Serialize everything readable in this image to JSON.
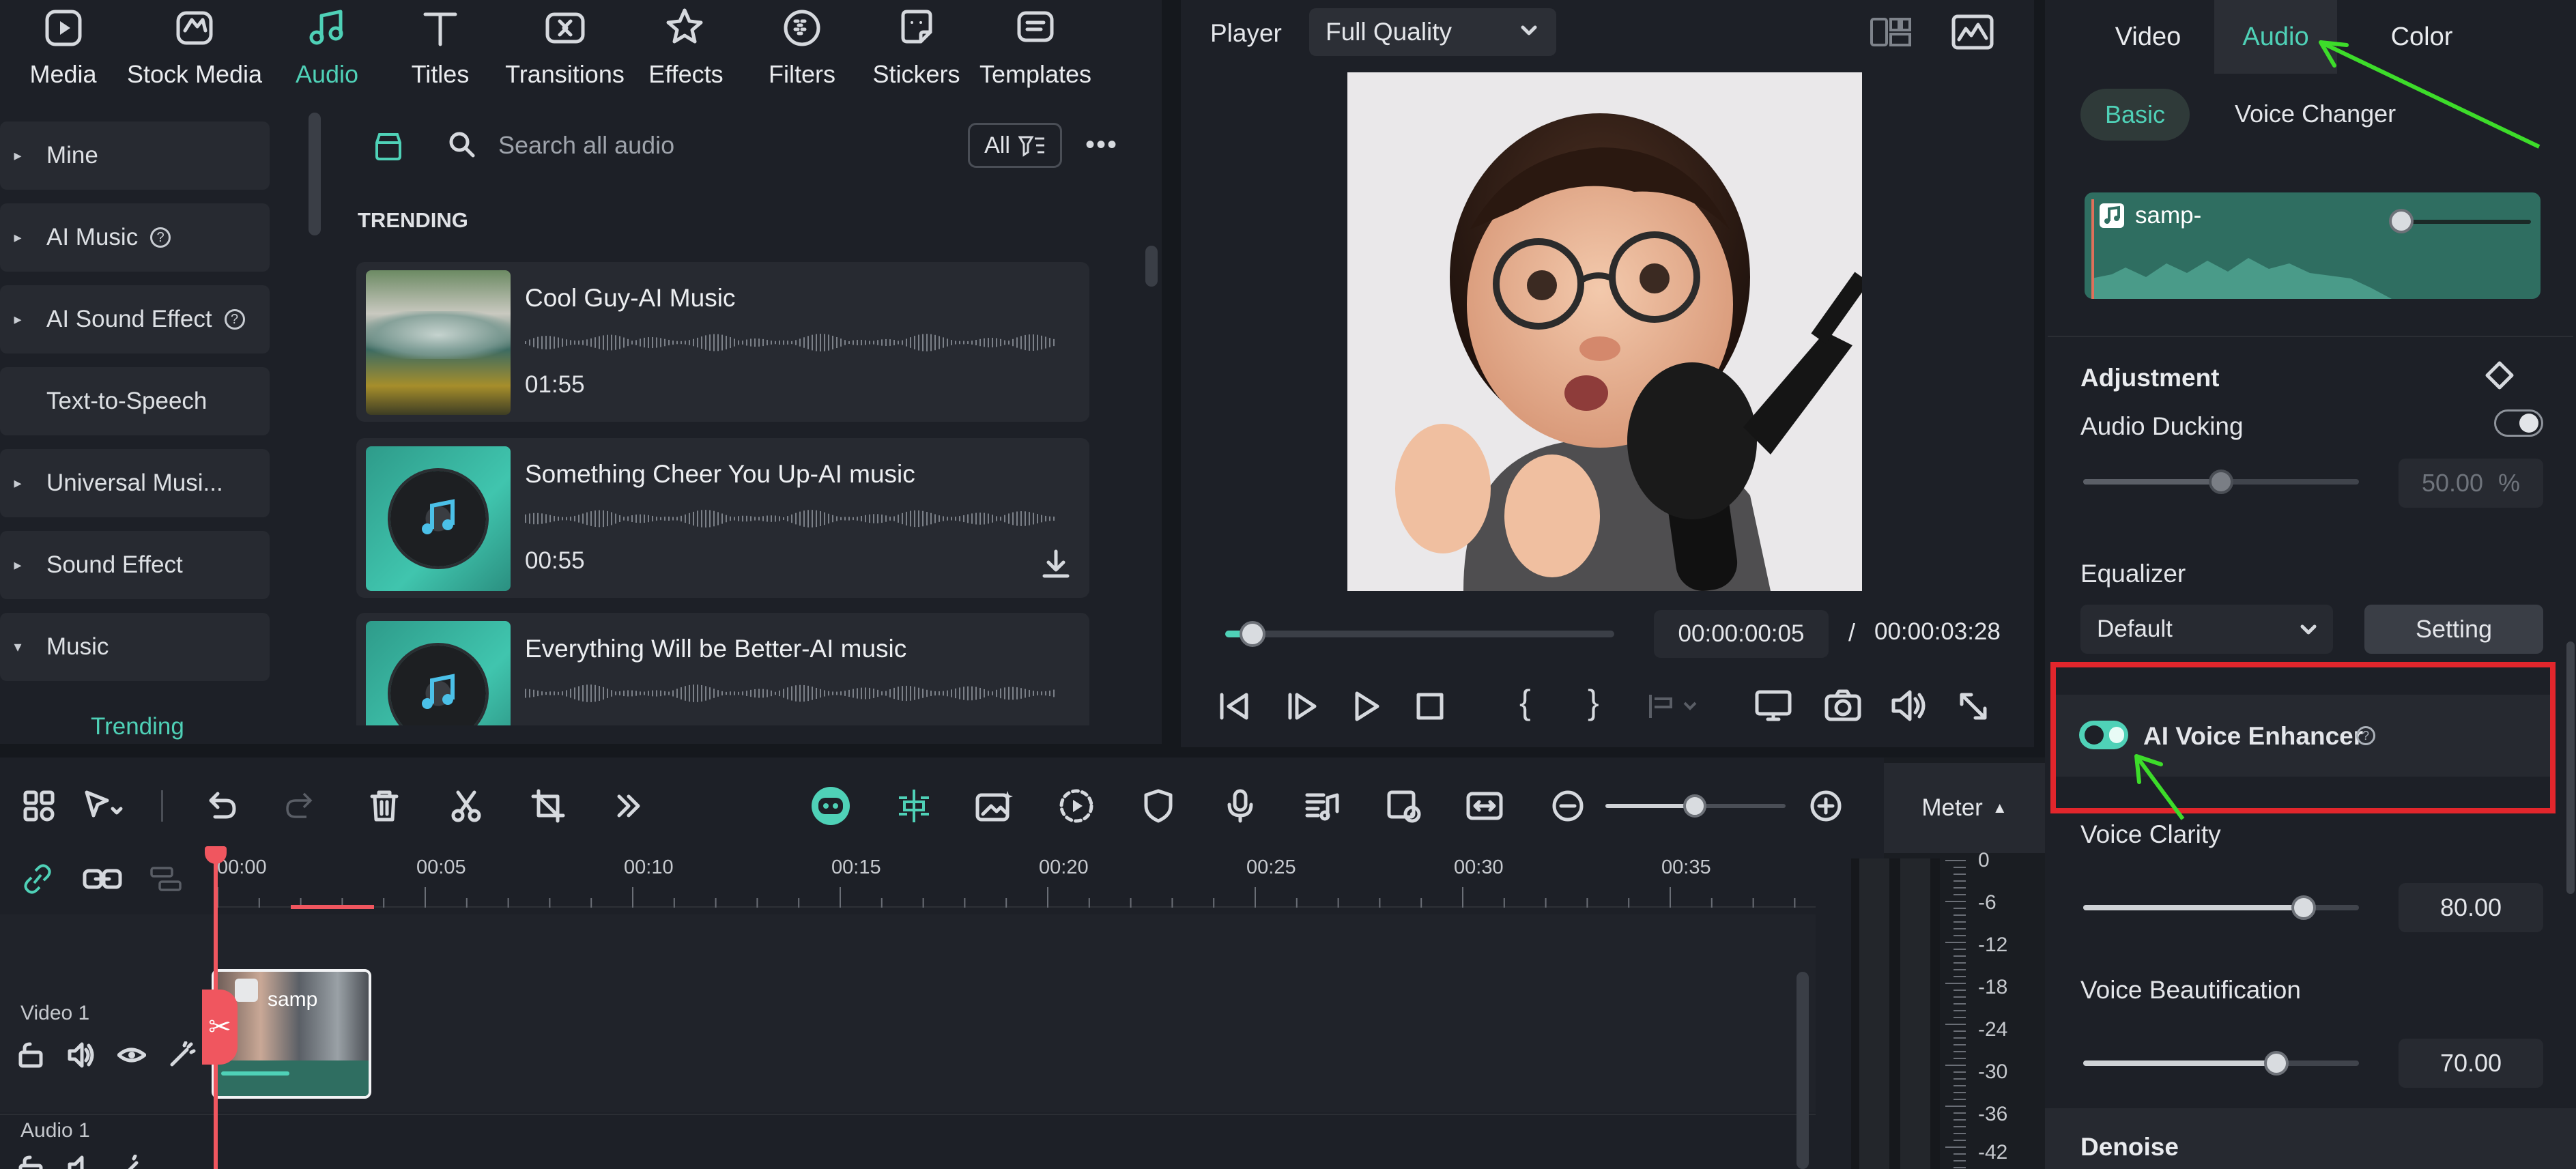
{
  "media_nav": {
    "tabs": [
      {
        "label": "Media",
        "icon": "media-icon"
      },
      {
        "label": "Stock Media",
        "icon": "stock-media-icon"
      },
      {
        "label": "Audio",
        "icon": "music-note-icon",
        "active": true
      },
      {
        "label": "Titles",
        "icon": "text-t-icon"
      },
      {
        "label": "Transitions",
        "icon": "transitions-icon"
      },
      {
        "label": "Effects",
        "icon": "effects-star-icon"
      },
      {
        "label": "Filters",
        "icon": "filters-icon"
      },
      {
        "label": "Stickers",
        "icon": "stickers-icon"
      },
      {
        "label": "Templates",
        "icon": "templates-icon"
      }
    ]
  },
  "sidebar": {
    "items": [
      {
        "label": "Mine",
        "caret": "▸"
      },
      {
        "label": "AI Music",
        "caret": "▸",
        "help": "?"
      },
      {
        "label": "AI Sound Effect",
        "caret": "▸",
        "help": "?"
      },
      {
        "label": "Text-to-Speech",
        "caret": ""
      },
      {
        "label": "Universal Musi...",
        "caret": "▸"
      },
      {
        "label": "Sound Effect",
        "caret": "▸"
      },
      {
        "label": "Music",
        "caret": "▾"
      }
    ],
    "sub_item": "Trending"
  },
  "search": {
    "placeholder": "Search all audio",
    "filter_label": "All"
  },
  "library": {
    "section_title": "TRENDING",
    "tracks": [
      {
        "title": "Cool Guy-AI Music",
        "duration": "01:55"
      },
      {
        "title": "Something Cheer You Up-AI music",
        "duration": "00:55"
      },
      {
        "title": "Everything Will be Better-AI music",
        "duration": ""
      }
    ]
  },
  "player": {
    "label": "Player",
    "quality": "Full Quality",
    "current_time": "00:00:00:05",
    "separator": "/",
    "total_time": "00:00:03:28",
    "progress": 0.07
  },
  "right_panel": {
    "tabs": [
      {
        "label": "Video"
      },
      {
        "label": "Audio",
        "active": true
      },
      {
        "label": "Color"
      }
    ],
    "subtabs": [
      {
        "label": "Basic",
        "active": true
      },
      {
        "label": "Voice Changer"
      }
    ],
    "clip_name": "samp-",
    "adjustment_title": "Adjustment",
    "audio_ducking": {
      "label": "Audio Ducking",
      "value": "50.00",
      "unit": "%",
      "level": 0.5,
      "enabled": false
    },
    "equalizer": {
      "label": "Equalizer",
      "preset": "Default",
      "setting_label": "Setting"
    },
    "ai_voice_enhancer": {
      "label": "AI Voice Enhancer",
      "enabled": true
    },
    "voice_clarity": {
      "label": "Voice Clarity",
      "value": "80.00",
      "level": 0.8
    },
    "voice_beautification": {
      "label": "Voice Beautification",
      "value": "70.00",
      "level": 0.7
    },
    "denoise_title": "Denoise"
  },
  "timeline": {
    "meter_label": "Meter",
    "ruler": [
      "00:00",
      "00:05",
      "00:10",
      "00:15",
      "00:20",
      "00:25",
      "00:30",
      "00:35"
    ],
    "video_track_label": "Video 1",
    "audio_track_label": "Audio 1",
    "clip_label": "samp",
    "meter_scale": [
      "0",
      "-6",
      "-12",
      "-18",
      "-24",
      "-30",
      "-36",
      "-42"
    ]
  },
  "colors": {
    "accent": "#4fd1b7",
    "highlight_box": "#e2262c",
    "annotation_arrow": "#3ddc2a",
    "playhead": "#f0565f",
    "panel_bg": "#1d2027",
    "card_bg": "#272a31"
  }
}
